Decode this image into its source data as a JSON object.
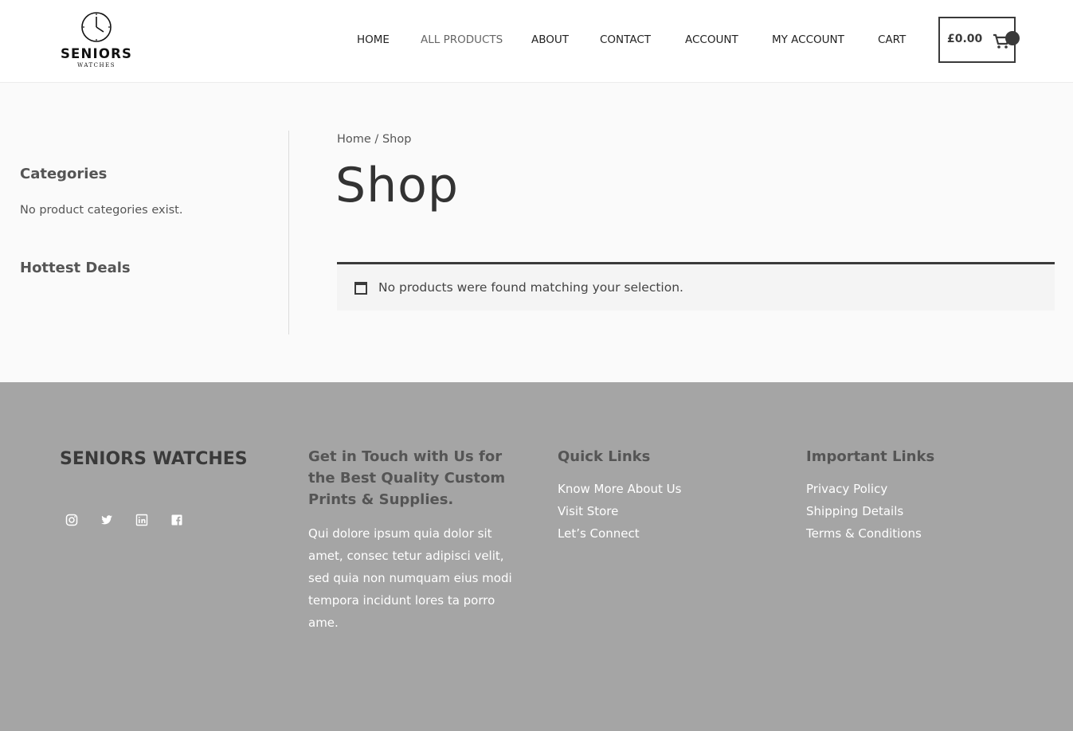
{
  "brand": {
    "logo_name": "SENIORS",
    "logo_sub": "WATCHES"
  },
  "nav": {
    "items": [
      {
        "label": "HOME",
        "active": false
      },
      {
        "label": "ALL PRODUCTS",
        "active": true
      },
      {
        "label": "ABOUT",
        "active": false
      },
      {
        "label": "CONTACT",
        "active": false
      },
      {
        "label": "ACCOUNT",
        "active": false
      },
      {
        "label": "MY ACCOUNT",
        "active": false
      },
      {
        "label": "CART",
        "active": false
      }
    ]
  },
  "cart": {
    "total": "£0.00",
    "icon": "cart-icon"
  },
  "sidebar": {
    "categories_heading": "Categories",
    "categories_empty": "No product categories exist.",
    "deals_heading": "Hottest Deals"
  },
  "main": {
    "breadcrumb_home": "Home",
    "breadcrumb_sep": " / ",
    "breadcrumb_current": "Shop",
    "title": "Shop",
    "notice": "No products were found matching your selection.",
    "notice_icon": "window-icon"
  },
  "footer": {
    "brand": "SENIORS WATCHES",
    "socials": [
      "instagram-icon",
      "twitter-icon",
      "linkedin-icon",
      "facebook-icon"
    ],
    "contact_heading": "Get in Touch with Us for the Best Quality Custom Prints & Supplies.",
    "contact_body": "Qui dolore ipsum quia dolor sit amet, consec tetur adipisci velit, sed quia non numquam eius modi tempora incidunt lores ta porro ame.",
    "quick_heading": "Quick Links",
    "quick_links": [
      "Know More About Us",
      "Visit Store",
      "Let’s Connect"
    ],
    "important_heading": "Important Links",
    "important_links": [
      "Privacy Policy",
      "Shipping Details",
      "Terms & Conditions"
    ]
  },
  "colors": {
    "header_bg": "#ffffff",
    "page_bg": "#fafafa",
    "footer_bg": "#a5a5a5",
    "text_dark": "#3a3a3a"
  }
}
